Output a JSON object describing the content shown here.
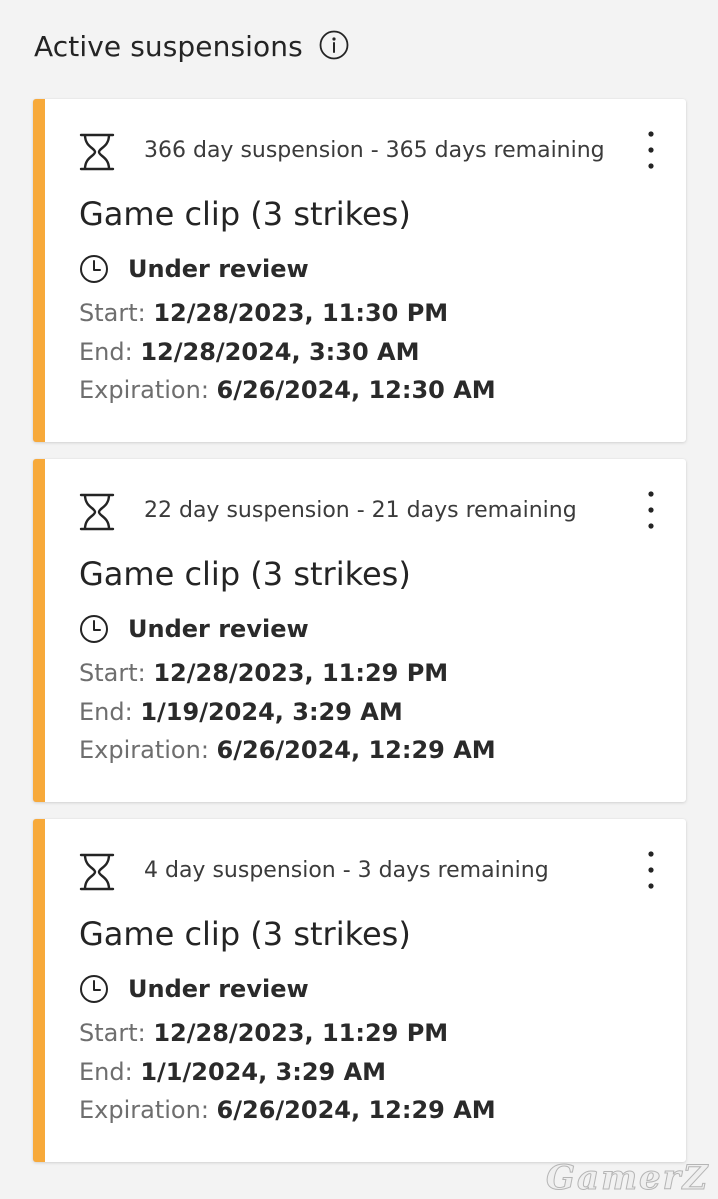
{
  "header": {
    "title": "Active suspensions",
    "info_icon": "info-circle-icon"
  },
  "accent_color": "#f7a93a",
  "cards": [
    {
      "duration": "366 day suspension - 365 days remaining",
      "title": "Game clip (3 strikes)",
      "status": "Under review",
      "start_label": "Start:",
      "start_value": "12/28/2023, 11:30 PM",
      "end_label": "End:",
      "end_value": "12/28/2024, 3:30 AM",
      "expiration_label": "Expiration:",
      "expiration_value": "6/26/2024, 12:30 AM"
    },
    {
      "duration": "22 day suspension - 21 days remaining",
      "title": "Game clip (3 strikes)",
      "status": "Under review",
      "start_label": "Start:",
      "start_value": "12/28/2023, 11:29 PM",
      "end_label": "End:",
      "end_value": "1/19/2024, 3:29 AM",
      "expiration_label": "Expiration:",
      "expiration_value": "6/26/2024, 12:29 AM"
    },
    {
      "duration": "4 day suspension - 3 days remaining",
      "title": "Game clip (3 strikes)",
      "status": "Under review",
      "start_label": "Start:",
      "start_value": "12/28/2023, 11:29 PM",
      "end_label": "End:",
      "end_value": "1/1/2024, 3:29 AM",
      "expiration_label": "Expiration:",
      "expiration_value": "6/26/2024, 12:29 AM"
    }
  ],
  "watermark": "GamerZ"
}
